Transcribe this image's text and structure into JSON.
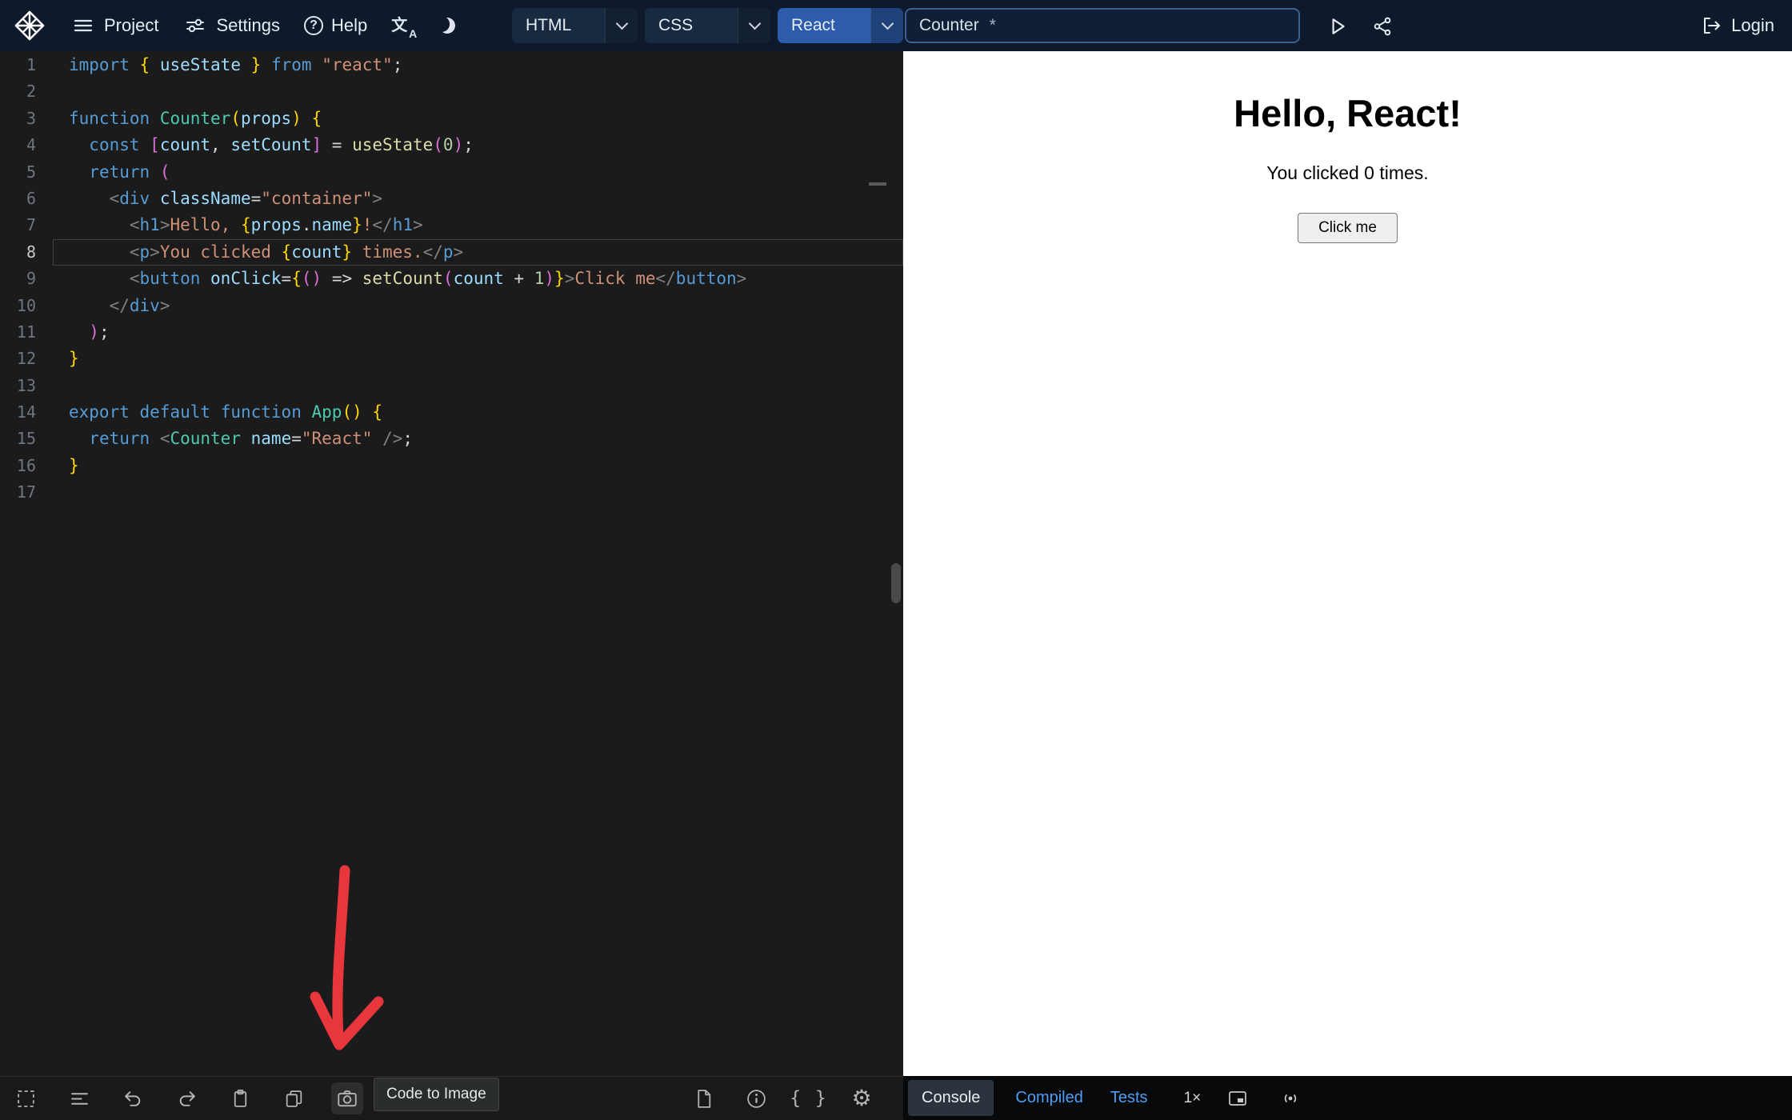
{
  "colors": {
    "topbar-bg": "#0e1a2b",
    "accent-blue": "#2c5cab",
    "editor-bg": "#1b1b1b",
    "link-blue": "#4f9df5",
    "arrow-red": "#e8363d",
    "kw": "#569cd6",
    "id": "#9cdcfe",
    "fn": "#4ec9b0",
    "call": "#dcdcaa",
    "str": "#ce9178",
    "num": "#b5cea8",
    "tag": "#569cd6",
    "attr": "#9cdcfe",
    "ab": "#808080",
    "b1": "#ffd700",
    "b2": "#da70d6",
    "txt": "#ce9178",
    "pl": "#d4d4d4"
  },
  "topbar": {
    "menu_project": "Project",
    "menu_settings": "Settings",
    "menu_help": "Help",
    "tabs": [
      {
        "label": "HTML"
      },
      {
        "label": "CSS"
      },
      {
        "label": "React"
      }
    ],
    "active_tab": "React",
    "project_name": "Counter",
    "unsaved_marker": "*",
    "login_label": "Login"
  },
  "editor": {
    "active_line": 8,
    "lines": [
      {
        "n": 1,
        "t": [
          [
            "kw",
            "import"
          ],
          [
            "pl",
            " "
          ],
          [
            "b1",
            "{"
          ],
          [
            "pl",
            " "
          ],
          [
            "id",
            "useState"
          ],
          [
            "pl",
            " "
          ],
          [
            "b1",
            "}"
          ],
          [
            "pl",
            " "
          ],
          [
            "kw",
            "from"
          ],
          [
            "pl",
            " "
          ],
          [
            "str",
            "\"react\""
          ],
          [
            "pl",
            ";"
          ]
        ]
      },
      {
        "n": 2,
        "t": []
      },
      {
        "n": 3,
        "t": [
          [
            "kw",
            "function"
          ],
          [
            "pl",
            " "
          ],
          [
            "fn",
            "Counter"
          ],
          [
            "b1",
            "("
          ],
          [
            "id",
            "props"
          ],
          [
            "b1",
            ")"
          ],
          [
            "pl",
            " "
          ],
          [
            "b1",
            "{"
          ]
        ]
      },
      {
        "n": 4,
        "t": [
          [
            "pl",
            "  "
          ],
          [
            "kw",
            "const"
          ],
          [
            "pl",
            " "
          ],
          [
            "b2",
            "["
          ],
          [
            "id",
            "count"
          ],
          [
            "pl",
            ", "
          ],
          [
            "id",
            "setCount"
          ],
          [
            "b2",
            "]"
          ],
          [
            "pl",
            " = "
          ],
          [
            "call",
            "useState"
          ],
          [
            "b2",
            "("
          ],
          [
            "num",
            "0"
          ],
          [
            "b2",
            ")"
          ],
          [
            "pl",
            ";"
          ]
        ]
      },
      {
        "n": 5,
        "t": [
          [
            "pl",
            "  "
          ],
          [
            "kw",
            "return"
          ],
          [
            "pl",
            " "
          ],
          [
            "b2",
            "("
          ]
        ]
      },
      {
        "n": 6,
        "t": [
          [
            "pl",
            "    "
          ],
          [
            "ab",
            "<"
          ],
          [
            "tag",
            "div"
          ],
          [
            "pl",
            " "
          ],
          [
            "attr",
            "className"
          ],
          [
            "pl",
            "="
          ],
          [
            "str",
            "\"container\""
          ],
          [
            "ab",
            ">"
          ]
        ]
      },
      {
        "n": 7,
        "t": [
          [
            "pl",
            "      "
          ],
          [
            "ab",
            "<"
          ],
          [
            "tag",
            "h1"
          ],
          [
            "ab",
            ">"
          ],
          [
            "txt",
            "Hello, "
          ],
          [
            "b1",
            "{"
          ],
          [
            "id",
            "props"
          ],
          [
            "pl",
            "."
          ],
          [
            "id",
            "name"
          ],
          [
            "b1",
            "}"
          ],
          [
            "txt",
            "!"
          ],
          [
            "ab",
            "</"
          ],
          [
            "tag",
            "h1"
          ],
          [
            "ab",
            ">"
          ]
        ]
      },
      {
        "n": 8,
        "t": [
          [
            "pl",
            "      "
          ],
          [
            "ab",
            "<"
          ],
          [
            "tag",
            "p"
          ],
          [
            "ab",
            ">"
          ],
          [
            "txt",
            "You clicked "
          ],
          [
            "b1",
            "{"
          ],
          [
            "id",
            "count"
          ],
          [
            "b1",
            "}"
          ],
          [
            "txt",
            " times."
          ],
          [
            "ab",
            "</"
          ],
          [
            "tag",
            "p"
          ],
          [
            "ab",
            ">"
          ]
        ]
      },
      {
        "n": 9,
        "t": [
          [
            "pl",
            "      "
          ],
          [
            "ab",
            "<"
          ],
          [
            "tag",
            "button"
          ],
          [
            "pl",
            " "
          ],
          [
            "attr",
            "onClick"
          ],
          [
            "pl",
            "="
          ],
          [
            "b1",
            "{"
          ],
          [
            "b2",
            "("
          ],
          [
            "b2",
            ")"
          ],
          [
            "pl",
            " => "
          ],
          [
            "call",
            "setCount"
          ],
          [
            "b2",
            "("
          ],
          [
            "id",
            "count"
          ],
          [
            "pl",
            " + "
          ],
          [
            "num",
            "1"
          ],
          [
            "b2",
            ")"
          ],
          [
            "b1",
            "}"
          ],
          [
            "ab",
            ">"
          ],
          [
            "txt",
            "Click me"
          ],
          [
            "ab",
            "</"
          ],
          [
            "tag",
            "button"
          ],
          [
            "ab",
            ">"
          ]
        ]
      },
      {
        "n": 10,
        "t": [
          [
            "pl",
            "    "
          ],
          [
            "ab",
            "</"
          ],
          [
            "tag",
            "div"
          ],
          [
            "ab",
            ">"
          ]
        ]
      },
      {
        "n": 11,
        "t": [
          [
            "pl",
            "  "
          ],
          [
            "b2",
            ")"
          ],
          [
            "pl",
            ";"
          ]
        ]
      },
      {
        "n": 12,
        "t": [
          [
            "b1",
            "}"
          ]
        ]
      },
      {
        "n": 13,
        "t": []
      },
      {
        "n": 14,
        "t": [
          [
            "kw",
            "export"
          ],
          [
            "pl",
            " "
          ],
          [
            "kw",
            "default"
          ],
          [
            "pl",
            " "
          ],
          [
            "kw",
            "function"
          ],
          [
            "pl",
            " "
          ],
          [
            "fn",
            "App"
          ],
          [
            "b1",
            "("
          ],
          [
            "b1",
            ")"
          ],
          [
            "pl",
            " "
          ],
          [
            "b1",
            "{"
          ]
        ]
      },
      {
        "n": 15,
        "t": [
          [
            "pl",
            "  "
          ],
          [
            "kw",
            "return"
          ],
          [
            "pl",
            " "
          ],
          [
            "ab",
            "<"
          ],
          [
            "fn",
            "Counter"
          ],
          [
            "pl",
            " "
          ],
          [
            "attr",
            "name"
          ],
          [
            "pl",
            "="
          ],
          [
            "str",
            "\"React\""
          ],
          [
            "pl",
            " "
          ],
          [
            "ab",
            "/>"
          ],
          [
            "pl",
            ";"
          ]
        ]
      },
      {
        "n": 16,
        "t": [
          [
            "b1",
            "}"
          ]
        ]
      },
      {
        "n": 17,
        "t": []
      }
    ]
  },
  "editor_toolbar": {
    "tooltip": "Code to Image"
  },
  "preview": {
    "heading": "Hello, React!",
    "status_text": "You clicked 0 times.",
    "button_label": "Click me"
  },
  "preview_bar": {
    "tabs": [
      "Console",
      "Compiled",
      "Tests"
    ],
    "active_tab": "Console",
    "zoom": "1×"
  }
}
